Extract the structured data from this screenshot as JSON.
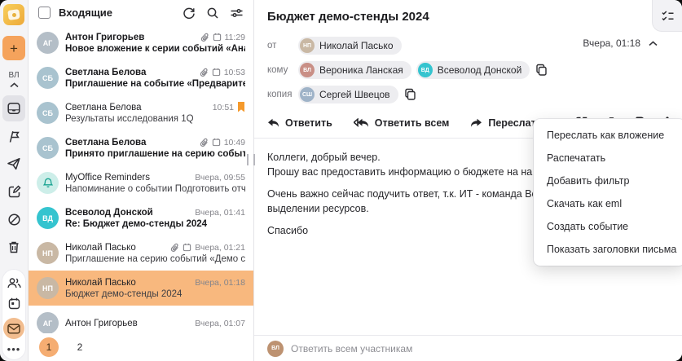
{
  "colors": {
    "accent": "#f5a35c",
    "selected_row": "#f8b87e",
    "flag_bookmark": "#f59a2d",
    "teal_avatar": "#35c4cf",
    "mail_circle": "#f2bd8f",
    "page_circle": "#f5ad72"
  },
  "sidebar": {
    "plus_label": "+",
    "user_initials": "ВЛ",
    "folder_icons": [
      "inbox-icon",
      "flag-icon",
      "paper-plane-icon",
      "compose-icon",
      "block-icon",
      "trash-icon"
    ],
    "selected_folder": "inbox-icon",
    "dock_icons": [
      "contacts-icon",
      "calendar-icon",
      "mail-icon"
    ],
    "active_app": "mail-icon"
  },
  "mail_list": {
    "header": {
      "title": "Входящие",
      "icons": [
        "refresh-icon",
        "search-icon",
        "filter-sliders-icon"
      ]
    },
    "rows": [
      {
        "name": "Антон Григорьев",
        "time": "11:29",
        "subject": "Новое вложение к серии событий «Аналити...",
        "unread": true,
        "has_attachment": true,
        "has_event": true,
        "flagged": false,
        "selected": false,
        "avatar": {
          "text": "АГ",
          "bg": "#b4bec7"
        }
      },
      {
        "name": "Светлана Белова",
        "time": "10:53",
        "subject": "Приглашение на событие «Предварительно...",
        "unread": true,
        "has_attachment": true,
        "has_event": true,
        "flagged": false,
        "selected": false,
        "avatar": {
          "text": "СБ",
          "bg": "#a9c3cf"
        }
      },
      {
        "name": "Светлана Белова",
        "time": "10:51",
        "subject": "Результаты исследования 1Q",
        "unread": false,
        "has_attachment": false,
        "has_event": false,
        "flagged": true,
        "selected": false,
        "avatar": {
          "text": "СБ",
          "bg": "#a9c3cf"
        }
      },
      {
        "name": "Светлана Белова",
        "time": "10:49",
        "subject": "Принято приглашение на серию событий «...",
        "unread": true,
        "has_attachment": true,
        "has_event": true,
        "flagged": false,
        "selected": false,
        "avatar": {
          "text": "СБ",
          "bg": "#a9c3cf"
        }
      },
      {
        "name": "MyOffice Reminders",
        "time": "Вчера, 09:55",
        "subject": "Напоминание о событии Подготовить отчет...",
        "unread": false,
        "has_attachment": false,
        "has_event": false,
        "flagged": false,
        "selected": false,
        "avatar": {
          "icon": "bell-icon",
          "bg": "#cdeee9",
          "fg": "#18a391"
        }
      },
      {
        "name": "Всеволод Донской",
        "time": "Вчера, 01:41",
        "subject": "Re: Бюджет демо-стенды 2024",
        "unread": true,
        "has_attachment": false,
        "has_event": false,
        "flagged": false,
        "selected": false,
        "avatar": {
          "text": "ВД",
          "bg": "#35c4cf"
        }
      },
      {
        "name": "Николай Пасько",
        "time": "Вчера, 01:21",
        "subject": "Приглашение на серию событий «Демо стен...",
        "unread": false,
        "has_attachment": true,
        "has_event": true,
        "flagged": false,
        "selected": false,
        "avatar": {
          "text": "НП",
          "bg": "#c9b8a4"
        }
      },
      {
        "name": "Николай Пасько",
        "time": "Вчера, 01:18",
        "subject": "Бюджет демо-стенды 2024",
        "unread": false,
        "has_attachment": false,
        "has_event": false,
        "flagged": false,
        "selected": true,
        "avatar": {
          "text": "НП",
          "bg": "#c9b8a4"
        }
      },
      {
        "name": "Антон Григорьев",
        "time": "Вчера, 01:07",
        "subject": "",
        "unread": false,
        "has_attachment": false,
        "has_event": false,
        "flagged": false,
        "selected": false,
        "avatar": {
          "text": "АГ",
          "bg": "#b4bec7"
        }
      }
    ],
    "pagination": {
      "pages": [
        "1",
        "2"
      ],
      "active": "1"
    }
  },
  "reading_pane": {
    "subject": "Бюджет демо-стенды 2024",
    "meta": {
      "from_label": "от",
      "to_label": "кому",
      "cc_label": "копия",
      "time": "Вчера, 01:18",
      "from": [
        {
          "name": "Николай Пасько",
          "avatar": {
            "text": "НП",
            "bg": "#c9b8a4"
          }
        }
      ],
      "to": [
        {
          "name": "Вероника Ланская",
          "avatar": {
            "text": "ВЛ",
            "bg": "#c98f86"
          }
        },
        {
          "name": "Всеволод Донской",
          "avatar": {
            "text": "ВД",
            "bg": "#35c4cf"
          }
        }
      ],
      "cc": [
        {
          "name": "Сергей Швецов",
          "avatar": {
            "text": "СШ",
            "bg": "#9fb3c8"
          }
        }
      ]
    },
    "actions": {
      "reply": "Ответить",
      "reply_all": "Ответить всем",
      "forward": "Переслать"
    },
    "action_icons": [
      "open-in-new-icon",
      "trash-icon",
      "tag-icon",
      "kebab-menu-icon"
    ],
    "body_lines": [
      "Коллеги, добрый вечер.",
      "Прошу вас предоставить информацию о бюджете на наши демонстраци",
      "",
      "Очень важно сейчас подучить ответ, т.к. ИТ - команда Всеволода, уже",
      "выделении ресурсов.",
      "",
      "Спасибо"
    ],
    "reply_bar": {
      "placeholder": "Ответить всем участникам",
      "avatar": {
        "text": "ВЛ",
        "bg": "#bd9271"
      }
    }
  },
  "context_menu": {
    "items": [
      "Переслать как вложение",
      "Распечатать",
      "Добавить фильтр",
      "Скачать как eml",
      "Создать событие",
      "Показать заголовки письма"
    ]
  }
}
